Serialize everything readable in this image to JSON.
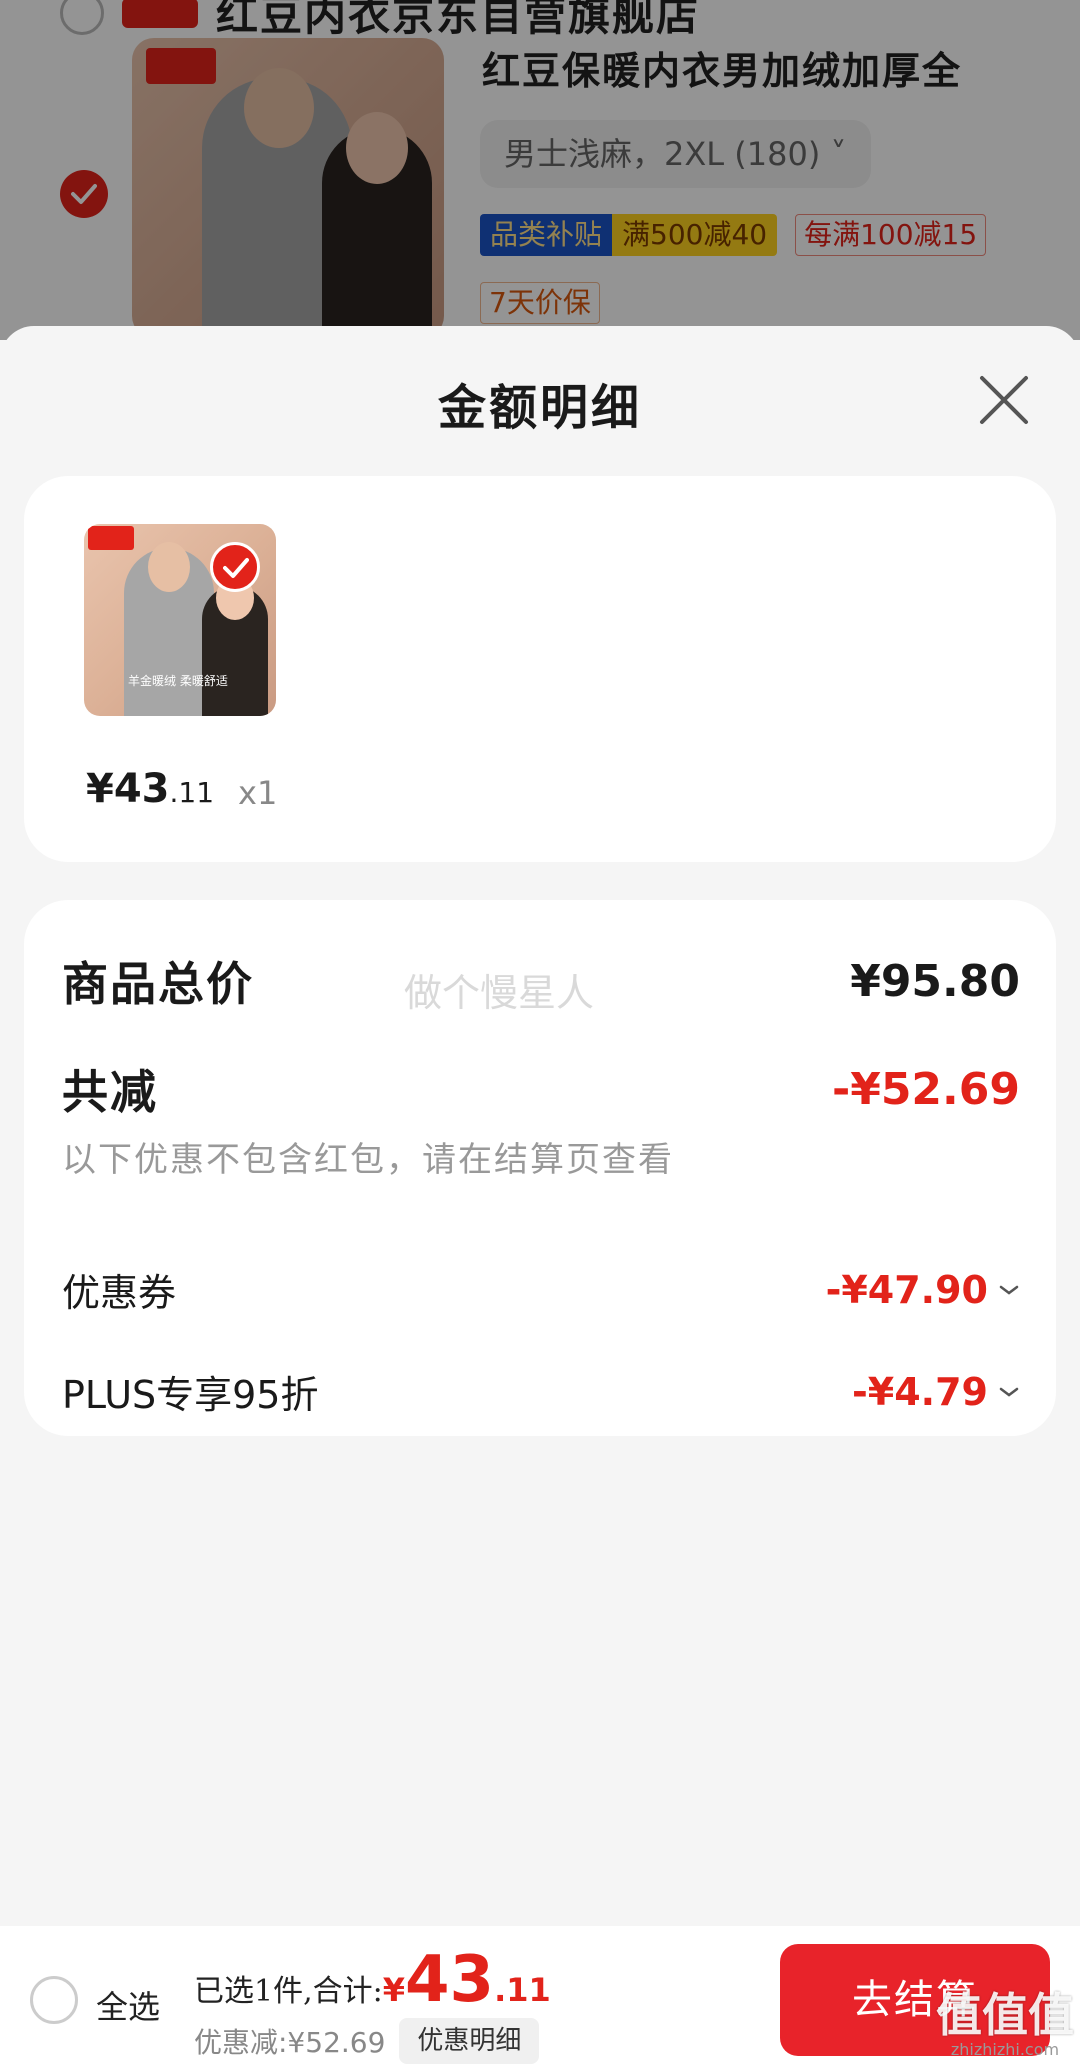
{
  "background_cart": {
    "shop_name": "红豆内衣京东自营旗舰店",
    "product_title": "红豆保暖内衣男加绒加厚全",
    "spec": "男士浅麻，2XL (180) ˅",
    "tag_subsidy_a": "品类补贴",
    "tag_subsidy_b": "满500减40",
    "tag_promo": "每满100减15",
    "tag_guarantee": "7天价保"
  },
  "sheet": {
    "title": "金额明细",
    "item": {
      "thumb_caption": "羊金暖绒 柔暖舒适",
      "price_int": "¥43",
      "price_dec": ".11",
      "qty": "x1"
    },
    "breakdown": {
      "total_label": "商品总价",
      "total_value": "¥95.80",
      "watermark": "做个慢星人",
      "discount_label": "共减",
      "discount_value": "-¥52.69",
      "note": "以下优惠不包含红包，请在结算页查看",
      "coupon_label": "优惠券",
      "coupon_value": "-¥47.90",
      "plus_label": "PLUS专享95折",
      "plus_value": "-¥4.79"
    }
  },
  "bottom_bar": {
    "select_all": "全选",
    "summary_text": "已选1件,合计:",
    "currency": "¥",
    "total_int": "43",
    "total_dec": ".11",
    "discount_text": "优惠减:¥52.69",
    "detail_button": "优惠明细",
    "checkout_button": "去结算"
  },
  "site_watermark": {
    "mark": "值值值",
    "url": "zhizhizhi.com"
  },
  "colors": {
    "accent_red": "#e2231a",
    "subsidy_blue": "#1b54c7",
    "subsidy_yellow": "#ffd21f"
  },
  "icons": [
    "check-icon",
    "close-icon",
    "chevron-down-icon"
  ]
}
